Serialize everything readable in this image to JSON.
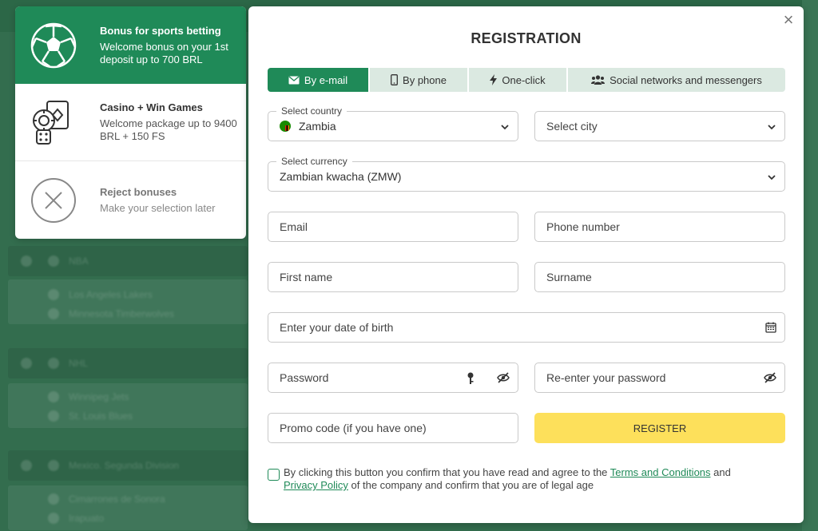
{
  "background": {
    "items": [
      "NBA",
      "Los Angeles Lakers",
      "Minnesota Timberwolves",
      "NHL",
      "Winnipeg Jets",
      "St. Louis Blues",
      "Mexico. Segunda Division",
      "Cimarrones de Sonora",
      "Irapuato"
    ]
  },
  "bonuses": [
    {
      "title": "Bonus for sports betting",
      "desc": "Welcome bonus on your 1st deposit up to 700 BRL",
      "icon": "soccer-ball-icon",
      "active": true
    },
    {
      "title": "Casino + Win Games",
      "desc": "Welcome package up to 9400 BRL + 150 FS",
      "icon": "casino-chips-dice-icon",
      "active": false
    },
    {
      "title": "Reject bonuses",
      "desc": "Make your selection later",
      "icon": "reject-x-icon",
      "active": false
    }
  ],
  "modal": {
    "title": "REGISTRATION",
    "close": "×",
    "tabs": [
      {
        "label": "By e-mail",
        "icon": "envelope-icon"
      },
      {
        "label": "By phone",
        "icon": "phone-icon"
      },
      {
        "label": "One-click",
        "icon": "lightning-icon"
      },
      {
        "label": "Social networks and messengers",
        "icon": "users-icon"
      }
    ],
    "country": {
      "label": "Select country",
      "value": "Zambia"
    },
    "city": {
      "placeholder": "Select city"
    },
    "currency": {
      "label": "Select currency",
      "value": "Zambian kwacha (ZMW)"
    },
    "email": {
      "placeholder": "Email"
    },
    "phone": {
      "placeholder": "Phone number"
    },
    "first_name": {
      "placeholder": "First name"
    },
    "surname": {
      "placeholder": "Surname"
    },
    "dob": {
      "placeholder": "Enter your date of birth"
    },
    "password": {
      "placeholder": "Password"
    },
    "password_confirm": {
      "placeholder": "Re-enter your password"
    },
    "promo": {
      "placeholder": "Promo code (if you have one)"
    },
    "register_label": "REGISTER",
    "agree": {
      "text1": "By clicking this button you confirm that you have read and agree to the ",
      "terms": "Terms and Conditions",
      "text2": " and ",
      "privacy": "Privacy Policy",
      "text3": " of the company and confirm that you are of legal age"
    }
  },
  "colors": {
    "accent": "#1f8a58",
    "register": "#fde05b",
    "tabs_bg": "#dbe9e1"
  }
}
